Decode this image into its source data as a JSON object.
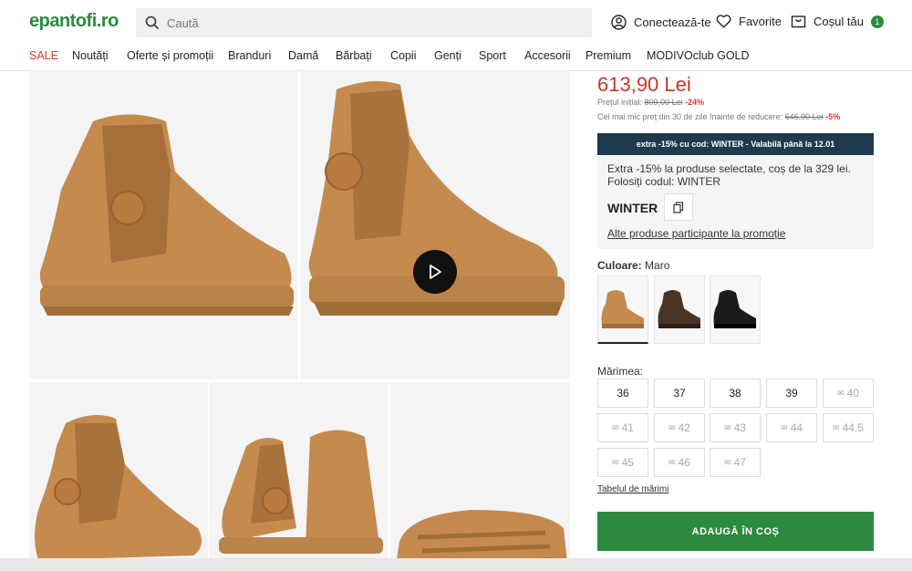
{
  "header": {
    "logo": "epantofi.ro",
    "search_placeholder": "Caută",
    "login_label": "Conectează-te",
    "favorites_label": "Favorite",
    "cart_label": "Coșul tău",
    "cart_count": "1"
  },
  "nav": [
    "SALE",
    "Noutăți",
    "Oferte și promoții",
    "Branduri",
    "Damă",
    "Bărbați",
    "Copii",
    "Genți",
    "Sport",
    "Accesorii",
    "Premium",
    "MODIVOclub GOLD"
  ],
  "product": {
    "price": "613,90 Lei",
    "initial_label": "Prețul inițial:",
    "initial_price": "809,00 Lei",
    "initial_discount": "-24%",
    "lowest_label": "Cel mai mic preț din 30 de zile înainte de reducere:",
    "lowest_price": "646,90 Lei",
    "lowest_discount": "-5%"
  },
  "promo": {
    "bar": "extra -15% cu cod: WINTER - Valabilă până la 12.01",
    "text": "Extra -15% la produse selectate, coș de la 329 lei. Folosiți codul: WINTER",
    "code": "WINTER",
    "link": "Alte produse participante la promoție"
  },
  "color": {
    "label": "Culoare:",
    "value": "Maro"
  },
  "sizes": {
    "label": "Mărimea:",
    "items": [
      "36",
      "37",
      "38",
      "39",
      "40",
      "41",
      "42",
      "43",
      "44",
      "44.5",
      "45",
      "46",
      "47"
    ],
    "table_link": "Tabelul de mărimi"
  },
  "add_to_cart": "ADAUGĂ ÎN COȘ",
  "colors": {
    "brand_green": "#2b8a3e",
    "price_red": "#c0392b",
    "promo_navy": "#1f3a4d",
    "boot_tan": "#c48a4e",
    "boot_dark": "#8b5a2b"
  }
}
